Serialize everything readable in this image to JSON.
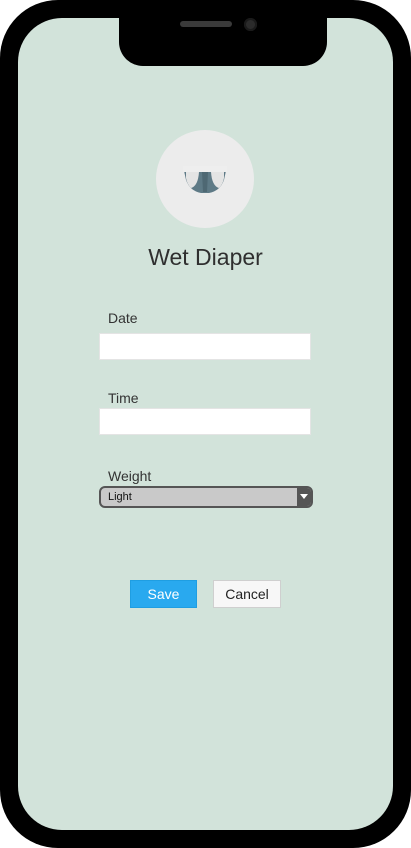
{
  "screen": {
    "title": "Wet Diaper",
    "icon": "diaper-icon",
    "accent_color": "#29a9ef",
    "background_color": "#d2e3da"
  },
  "form": {
    "date_label": "Date",
    "date_value": "",
    "time_label": "Time",
    "time_value": "",
    "weight_label": "Weight",
    "weight_value": "Light"
  },
  "actions": {
    "save_label": "Save",
    "cancel_label": "Cancel"
  }
}
